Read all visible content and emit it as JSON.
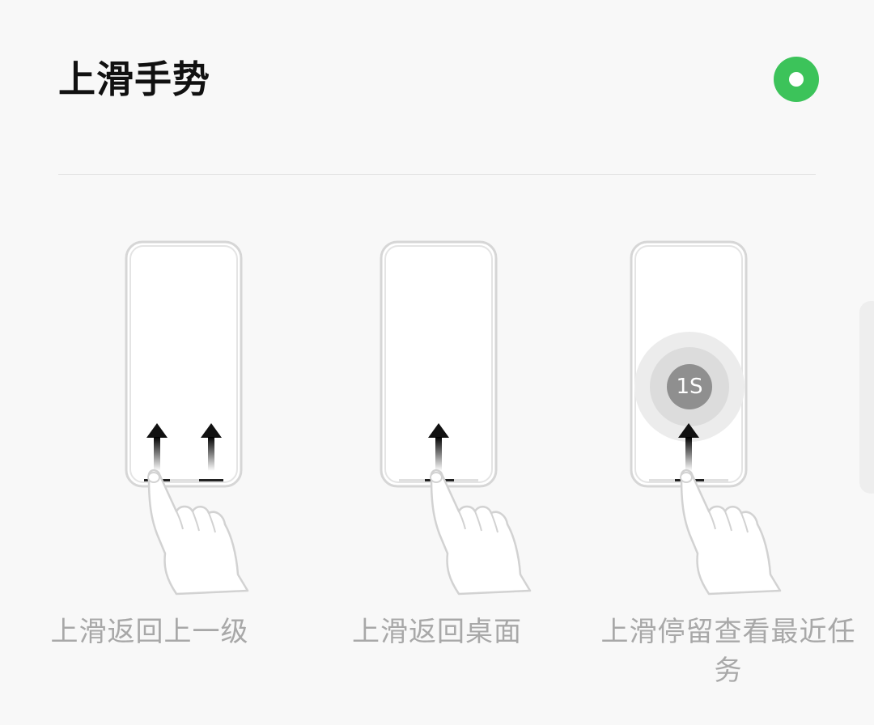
{
  "header": {
    "title": "上滑手势",
    "radio_selected": true,
    "accent_color": "#3cc35a"
  },
  "options": [
    {
      "caption": "上滑返回上一级",
      "arrows": 2,
      "hold_badge": ""
    },
    {
      "caption": "上滑返回桌面",
      "arrows": 1,
      "hold_badge": ""
    },
    {
      "caption": "上滑停留查看最近任务",
      "arrows": 1,
      "hold_badge": "1S"
    }
  ]
}
